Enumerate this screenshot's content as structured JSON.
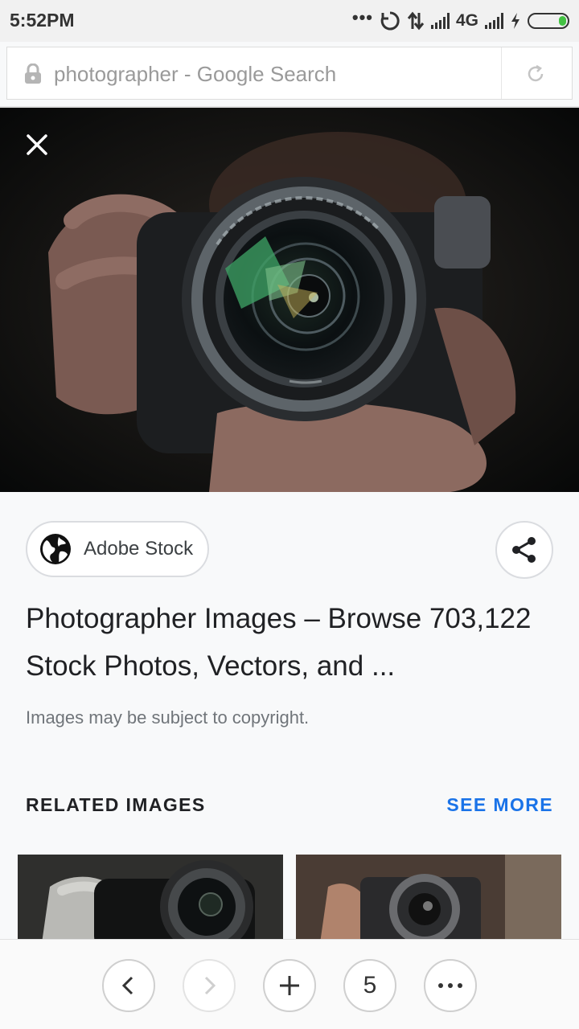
{
  "status_bar": {
    "time": "5:52PM",
    "network": "4G"
  },
  "address_bar": {
    "text": "photographer - Google Search"
  },
  "image_viewer": {
    "image_description_icon": "camera-lens-photo"
  },
  "source": {
    "label": "Adobe Stock"
  },
  "result": {
    "title": "Photographer Images – Browse 703,122 Stock Photos, Vectors, and ...",
    "copyright": "Images may be subject to copyright."
  },
  "related": {
    "heading": "RELATED IMAGES",
    "see_more": "SEE MORE"
  },
  "bottom_nav": {
    "tab_count": "5"
  },
  "colors": {
    "accent": "#1a73e8",
    "battery": "#43c243"
  }
}
